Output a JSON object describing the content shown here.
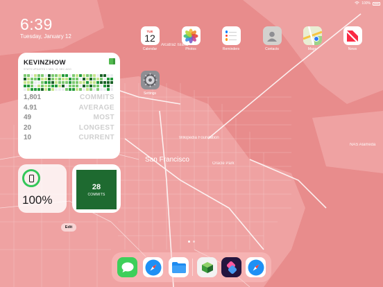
{
  "status_bar": {
    "battery_text": "100%"
  },
  "lock": {
    "time": "6:39",
    "date": "Tuesday, January 12"
  },
  "github_widget": {
    "username": "KEVINZHOW",
    "subtitle": "STATS UPDATED 1 MIN, 41 SEC AGO",
    "stats": [
      {
        "value": "1,801",
        "label": "COMMITS"
      },
      {
        "value": "4.91",
        "label": "AVERAGE"
      },
      {
        "value": "49",
        "label": "MOST"
      },
      {
        "value": "20",
        "label": "LONGEST"
      },
      {
        "value": "10",
        "label": "CURRENT"
      }
    ],
    "colors": {
      "level0": "#ebedf0",
      "level1": "#c6e48b",
      "level2": "#7bc96f",
      "level3": "#239a3b",
      "level4": "#196127"
    }
  },
  "battery_widget": {
    "percent": "100%",
    "ring_color": "#34c759"
  },
  "commits_widget": {
    "count": "28",
    "label": "COMMITS",
    "bg_color": "#1e6a30"
  },
  "edit_button": {
    "label": "Edit"
  },
  "apps": {
    "calendar": {
      "label": "Calendar",
      "dow": "TUE",
      "day": "12",
      "icon": "calendar-icon"
    },
    "photos": {
      "label": "Photos",
      "icon": "photos-icon"
    },
    "reminders": {
      "label": "Reminders",
      "icon": "reminders-icon"
    },
    "contacts": {
      "label": "Contacts",
      "icon": "contacts-icon"
    },
    "maps": {
      "label": "Maps",
      "icon": "maps-icon"
    },
    "news": {
      "label": "News",
      "icon": "news-icon"
    },
    "settings": {
      "label": "Settings",
      "icon": "gear-icon"
    }
  },
  "dock": {
    "apps": [
      "messages-icon",
      "safari-icon",
      "files-icon",
      "cube-app-icon",
      "shortcuts-icon",
      "safari-recent-icon"
    ]
  },
  "map_labels": {
    "city": "San Francisco",
    "alcatraz": "Alcatraz Island",
    "nas": "NAS Alameda",
    "wikipedia": "Wikipedia Foundation",
    "oracle": "Oracle Park"
  },
  "page_indicator": {
    "pages": 2,
    "current": 1
  }
}
